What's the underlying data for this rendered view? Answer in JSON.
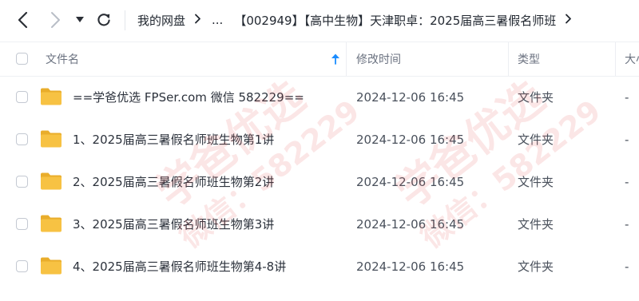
{
  "colors": {
    "folder": "#f7c243",
    "folder_back": "#e9ad2b",
    "sort_arrow": "#1a8cff",
    "watermark": "#e84a4a"
  },
  "nav": {
    "back_icon": "chevron-left-icon",
    "forward_icon": "chevron-right-icon",
    "history_icon": "caret-down-icon",
    "refresh_icon": "refresh-icon"
  },
  "breadcrumb": {
    "root": "我的网盘",
    "ellipsis": "...",
    "current": "【002949】【高中生物】天津职卓：2025届高三暑假名师班"
  },
  "header": {
    "name": "文件名",
    "modified": "修改时间",
    "type": "类型",
    "size": "大小"
  },
  "files": [
    {
      "name": "==学爸优选 FPSer.com 微信 582229==",
      "modified": "2024-12-06 16:45",
      "type": "文件夹",
      "size": "-"
    },
    {
      "name": "1、2025届高三暑假名师班生物第1讲",
      "modified": "2024-12-06 16:45",
      "type": "文件夹",
      "size": "-"
    },
    {
      "name": "2、2025届高三暑假名师班生物第2讲",
      "modified": "2024-12-06 16:45",
      "type": "文件夹",
      "size": "-"
    },
    {
      "name": "3、2025届高三暑假名师班生物第3讲",
      "modified": "2024-12-06 16:45",
      "type": "文件夹",
      "size": "-"
    },
    {
      "name": "4、2025届高三暑假名师班生物第4-8讲",
      "modified": "2024-12-06 16:45",
      "type": "文件夹",
      "size": "-"
    }
  ],
  "watermark": {
    "brand": "学爸优选",
    "wechat": "微信：582229"
  }
}
